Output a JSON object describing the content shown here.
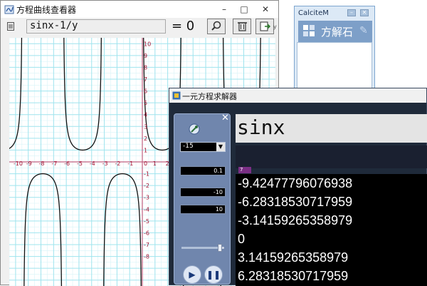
{
  "viewer": {
    "title": "方程曲线查看器",
    "expression": "sinx-1/y",
    "equals": "= 0",
    "toolbar_side_label": "y",
    "controls": {
      "minimize": "–",
      "maximize": "□",
      "close": "✕"
    },
    "plot": {
      "xlim": [
        -10.5,
        10.5
      ],
      "ylim": [
        -10.5,
        10.5
      ],
      "x_ticks": [
        "-10",
        "-9",
        "-8",
        "-7",
        "-6",
        "-5",
        "-4",
        "-3",
        "-2",
        "-1",
        "0",
        "1",
        "2",
        "3",
        "4",
        "5",
        "6",
        "7",
        "8",
        "9",
        "10"
      ],
      "y_ticks": [
        "10",
        "9",
        "8",
        "7",
        "6",
        "5",
        "4",
        "3",
        "2",
        "1",
        "-1",
        "-2",
        "-3",
        "-4",
        "-5",
        "-6",
        "-7",
        "-8"
      ],
      "equation": "sin(x) - 1/y = 0",
      "colors": {
        "grid": "#9fe4ee",
        "axis": "#c06080",
        "curve": "#111111",
        "tick_label": "#a01030",
        "minor_grid": "#d8f4f8"
      }
    }
  },
  "calcite": {
    "title": "CalciteM",
    "logo_text": "方解石",
    "controls": {
      "minimize": "–",
      "close": "✕"
    }
  },
  "solver": {
    "title": "一元方程求解器",
    "panel": {
      "close": "✕",
      "start_value": "-15",
      "step": "0.1",
      "min": "-10",
      "max": "10",
      "speed_level": 0.9
    },
    "equation": "sinx",
    "count": "7",
    "results": [
      "-9.42477796076938",
      "-6.28318530717959",
      "-3.14159265358979",
      " 0",
      " 3.14159265358979",
      " 6.28318530717959"
    ],
    "play_icon": "play-icon",
    "pause_icon": "pause-icon"
  }
}
